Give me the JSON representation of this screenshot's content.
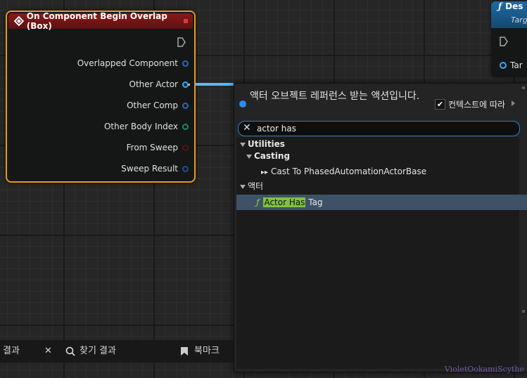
{
  "event_node": {
    "title": "On Component Begin Overlap (Box)",
    "pins": [
      {
        "label": "Overlapped Component",
        "color": "#2a8ad0"
      },
      {
        "label": "Other Actor",
        "color": "#2f9ef0"
      },
      {
        "label": "Other Comp",
        "color": "#2a8ad0"
      },
      {
        "label": "Other Body Index",
        "color": "#1fa36a"
      },
      {
        "label": "From Sweep",
        "color": "#7a1515"
      },
      {
        "label": "Sweep Result",
        "color": "#2a6ab0"
      }
    ]
  },
  "function_node": {
    "title": "Des",
    "subtitle": "Targ",
    "pin_label": "Tar"
  },
  "menu": {
    "title": "액터 오브젝트 레퍼런스 받는 액션입니다.",
    "context_label": "컨텍스트에 따라",
    "context_checked": true,
    "search_value": "actor has",
    "results": {
      "cat1": "Utilities",
      "sub1": "Casting",
      "item1": "Cast To PhasedAutomationActorBase",
      "cat2": "액터",
      "item2_match": "Actor Has",
      "item2_rest": " Tag"
    }
  },
  "bottom_tabs": {
    "results_label": "결과",
    "find_label": "찾기 결과",
    "bookmark_label": "북마크"
  },
  "watermark": "VioletOokamiScythe",
  "colors": {
    "accent": "#2a8cf0",
    "event_border": "#e59b17",
    "event_header": "#8a1a1a",
    "highlight": "#7fc242",
    "selected_row": "#3e5166"
  }
}
